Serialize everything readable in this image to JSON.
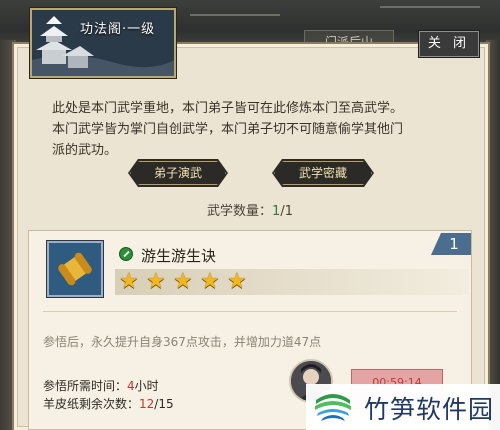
{
  "header": {
    "title": "功法阁·一级"
  },
  "background": {
    "tab_label": "门派后山"
  },
  "close_button": {
    "label": "关 闭"
  },
  "description": {
    "lines": [
      "此处是本门武学重地，本门弟子皆可在此修炼本门至高武学。",
      "本门武学皆为掌门自创武学，本门弟子切不可随意偷学其他门",
      "派的武功。"
    ]
  },
  "buttons": {
    "demo": "弟子演武",
    "secret": "武学密藏"
  },
  "skill_count": {
    "label": "武学数量：",
    "current": "1",
    "total": "/1"
  },
  "skill": {
    "name": "游生游生诀",
    "level": "1",
    "stars": 5,
    "star_glyph": "★",
    "effect": "参悟后，永久提升自身367点攻击，并增加力道47点",
    "time_label": "参悟所需时间：",
    "time_value": "4",
    "time_unit": "小时",
    "paper_label": "羊皮纸剩余次数：",
    "paper_value": "12",
    "paper_total": "/15",
    "learn_button": "00:59:14"
  },
  "watermark": {
    "text": "竹笋软件园"
  },
  "colors": {
    "parchment": "#ece4d2",
    "star": "#f2b620",
    "level_badge": "#4b6e8e",
    "count_highlight": "#2f7a33",
    "warn": "#c0392b"
  }
}
